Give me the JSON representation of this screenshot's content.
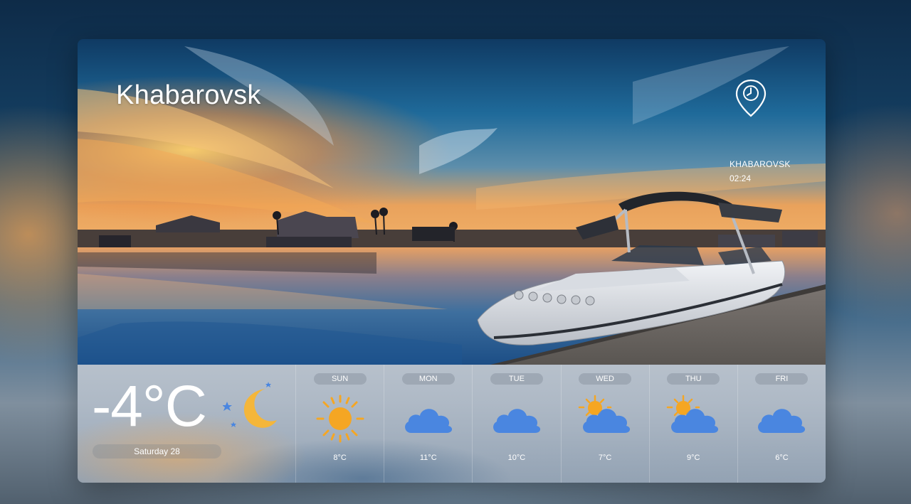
{
  "hero": {
    "city": "Khabarovsk",
    "clock": {
      "location": "KHABAROVSK",
      "time": "02:24",
      "icon": "clock-pin-icon"
    }
  },
  "current": {
    "temperature": "-4°C",
    "date": "Saturday 28",
    "icon": "moon-stars-icon"
  },
  "forecast": [
    {
      "day": "SUN",
      "temp": "8°C",
      "icon": "sun-icon"
    },
    {
      "day": "MON",
      "temp": "11°C",
      "icon": "cloud-icon"
    },
    {
      "day": "TUE",
      "temp": "10°C",
      "icon": "cloud-icon"
    },
    {
      "day": "WED",
      "temp": "7°C",
      "icon": "partly-cloudy-icon"
    },
    {
      "day": "THU",
      "temp": "9°C",
      "icon": "partly-cloudy-icon"
    },
    {
      "day": "FRI",
      "temp": "6°C",
      "icon": "cloud-icon"
    }
  ],
  "colors": {
    "sun": "#f5a623",
    "cloud": "#4a86e0",
    "moon": "#f4b63a",
    "star": "#4a86e0"
  }
}
